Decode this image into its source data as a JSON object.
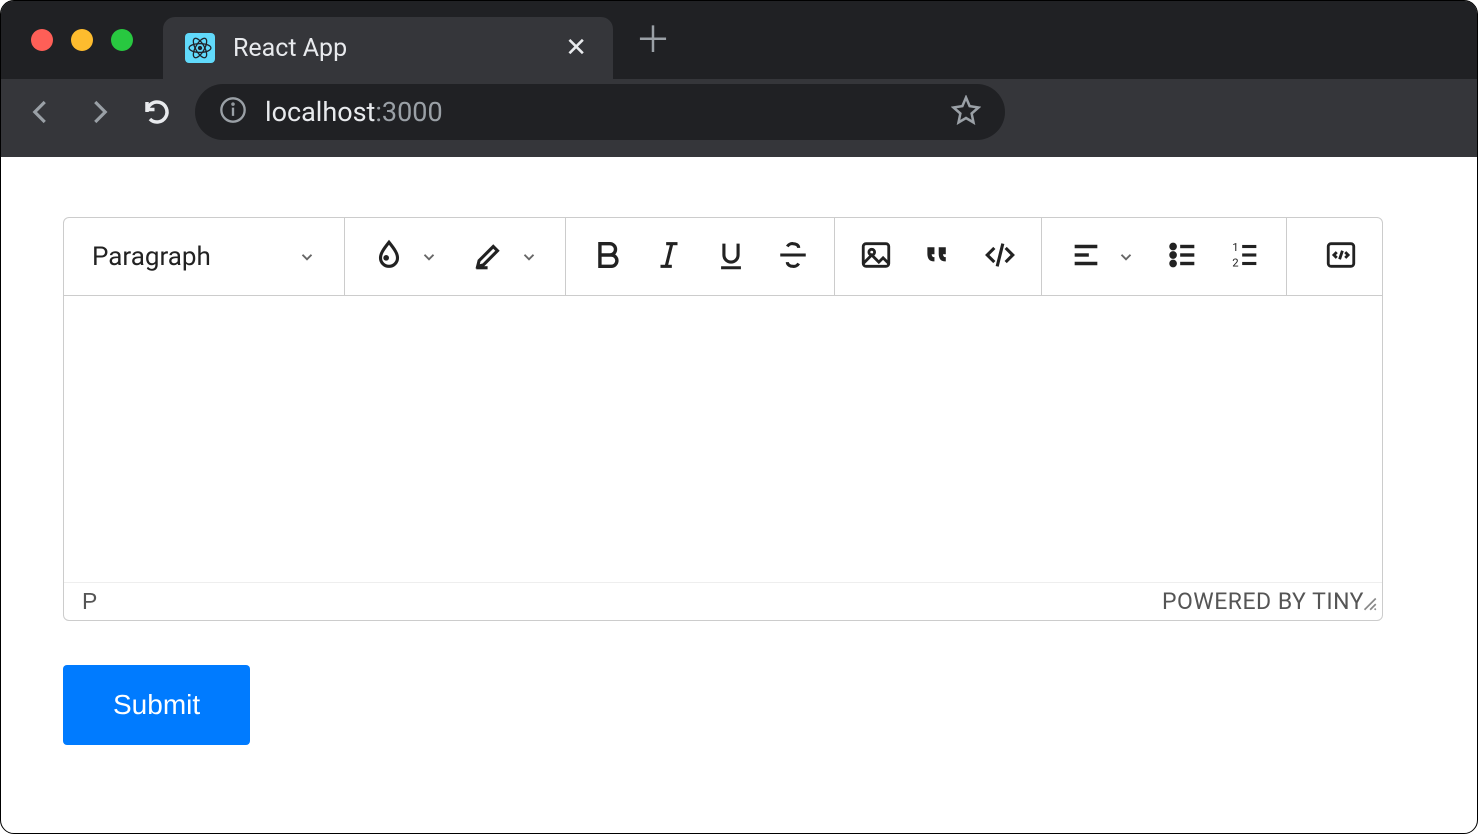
{
  "browser": {
    "tab_title": "React App",
    "url_host": "localhost",
    "url_port": ":3000"
  },
  "editor": {
    "format_selector": "Paragraph",
    "status_path": "P",
    "attribution": "POWERED BY TINY"
  },
  "page": {
    "submit_label": "Submit"
  }
}
